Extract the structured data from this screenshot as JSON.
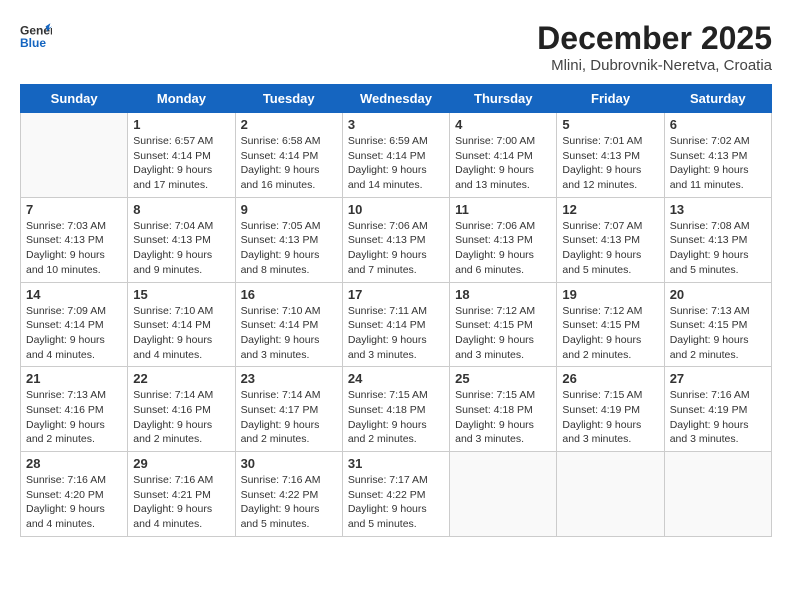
{
  "header": {
    "logo_general": "General",
    "logo_blue": "Blue",
    "title": "December 2025",
    "subtitle": "Mlini, Dubrovnik-Neretva, Croatia"
  },
  "weekdays": [
    "Sunday",
    "Monday",
    "Tuesday",
    "Wednesday",
    "Thursday",
    "Friday",
    "Saturday"
  ],
  "weeks": [
    [
      {
        "day": "",
        "sunrise": "",
        "sunset": "",
        "daylight": ""
      },
      {
        "day": "1",
        "sunrise": "Sunrise: 6:57 AM",
        "sunset": "Sunset: 4:14 PM",
        "daylight": "Daylight: 9 hours and 17 minutes."
      },
      {
        "day": "2",
        "sunrise": "Sunrise: 6:58 AM",
        "sunset": "Sunset: 4:14 PM",
        "daylight": "Daylight: 9 hours and 16 minutes."
      },
      {
        "day": "3",
        "sunrise": "Sunrise: 6:59 AM",
        "sunset": "Sunset: 4:14 PM",
        "daylight": "Daylight: 9 hours and 14 minutes."
      },
      {
        "day": "4",
        "sunrise": "Sunrise: 7:00 AM",
        "sunset": "Sunset: 4:14 PM",
        "daylight": "Daylight: 9 hours and 13 minutes."
      },
      {
        "day": "5",
        "sunrise": "Sunrise: 7:01 AM",
        "sunset": "Sunset: 4:13 PM",
        "daylight": "Daylight: 9 hours and 12 minutes."
      },
      {
        "day": "6",
        "sunrise": "Sunrise: 7:02 AM",
        "sunset": "Sunset: 4:13 PM",
        "daylight": "Daylight: 9 hours and 11 minutes."
      }
    ],
    [
      {
        "day": "7",
        "sunrise": "Sunrise: 7:03 AM",
        "sunset": "Sunset: 4:13 PM",
        "daylight": "Daylight: 9 hours and 10 minutes."
      },
      {
        "day": "8",
        "sunrise": "Sunrise: 7:04 AM",
        "sunset": "Sunset: 4:13 PM",
        "daylight": "Daylight: 9 hours and 9 minutes."
      },
      {
        "day": "9",
        "sunrise": "Sunrise: 7:05 AM",
        "sunset": "Sunset: 4:13 PM",
        "daylight": "Daylight: 9 hours and 8 minutes."
      },
      {
        "day": "10",
        "sunrise": "Sunrise: 7:06 AM",
        "sunset": "Sunset: 4:13 PM",
        "daylight": "Daylight: 9 hours and 7 minutes."
      },
      {
        "day": "11",
        "sunrise": "Sunrise: 7:06 AM",
        "sunset": "Sunset: 4:13 PM",
        "daylight": "Daylight: 9 hours and 6 minutes."
      },
      {
        "day": "12",
        "sunrise": "Sunrise: 7:07 AM",
        "sunset": "Sunset: 4:13 PM",
        "daylight": "Daylight: 9 hours and 5 minutes."
      },
      {
        "day": "13",
        "sunrise": "Sunrise: 7:08 AM",
        "sunset": "Sunset: 4:13 PM",
        "daylight": "Daylight: 9 hours and 5 minutes."
      }
    ],
    [
      {
        "day": "14",
        "sunrise": "Sunrise: 7:09 AM",
        "sunset": "Sunset: 4:14 PM",
        "daylight": "Daylight: 9 hours and 4 minutes."
      },
      {
        "day": "15",
        "sunrise": "Sunrise: 7:10 AM",
        "sunset": "Sunset: 4:14 PM",
        "daylight": "Daylight: 9 hours and 4 minutes."
      },
      {
        "day": "16",
        "sunrise": "Sunrise: 7:10 AM",
        "sunset": "Sunset: 4:14 PM",
        "daylight": "Daylight: 9 hours and 3 minutes."
      },
      {
        "day": "17",
        "sunrise": "Sunrise: 7:11 AM",
        "sunset": "Sunset: 4:14 PM",
        "daylight": "Daylight: 9 hours and 3 minutes."
      },
      {
        "day": "18",
        "sunrise": "Sunrise: 7:12 AM",
        "sunset": "Sunset: 4:15 PM",
        "daylight": "Daylight: 9 hours and 3 minutes."
      },
      {
        "day": "19",
        "sunrise": "Sunrise: 7:12 AM",
        "sunset": "Sunset: 4:15 PM",
        "daylight": "Daylight: 9 hours and 2 minutes."
      },
      {
        "day": "20",
        "sunrise": "Sunrise: 7:13 AM",
        "sunset": "Sunset: 4:15 PM",
        "daylight": "Daylight: 9 hours and 2 minutes."
      }
    ],
    [
      {
        "day": "21",
        "sunrise": "Sunrise: 7:13 AM",
        "sunset": "Sunset: 4:16 PM",
        "daylight": "Daylight: 9 hours and 2 minutes."
      },
      {
        "day": "22",
        "sunrise": "Sunrise: 7:14 AM",
        "sunset": "Sunset: 4:16 PM",
        "daylight": "Daylight: 9 hours and 2 minutes."
      },
      {
        "day": "23",
        "sunrise": "Sunrise: 7:14 AM",
        "sunset": "Sunset: 4:17 PM",
        "daylight": "Daylight: 9 hours and 2 minutes."
      },
      {
        "day": "24",
        "sunrise": "Sunrise: 7:15 AM",
        "sunset": "Sunset: 4:18 PM",
        "daylight": "Daylight: 9 hours and 2 minutes."
      },
      {
        "day": "25",
        "sunrise": "Sunrise: 7:15 AM",
        "sunset": "Sunset: 4:18 PM",
        "daylight": "Daylight: 9 hours and 3 minutes."
      },
      {
        "day": "26",
        "sunrise": "Sunrise: 7:15 AM",
        "sunset": "Sunset: 4:19 PM",
        "daylight": "Daylight: 9 hours and 3 minutes."
      },
      {
        "day": "27",
        "sunrise": "Sunrise: 7:16 AM",
        "sunset": "Sunset: 4:19 PM",
        "daylight": "Daylight: 9 hours and 3 minutes."
      }
    ],
    [
      {
        "day": "28",
        "sunrise": "Sunrise: 7:16 AM",
        "sunset": "Sunset: 4:20 PM",
        "daylight": "Daylight: 9 hours and 4 minutes."
      },
      {
        "day": "29",
        "sunrise": "Sunrise: 7:16 AM",
        "sunset": "Sunset: 4:21 PM",
        "daylight": "Daylight: 9 hours and 4 minutes."
      },
      {
        "day": "30",
        "sunrise": "Sunrise: 7:16 AM",
        "sunset": "Sunset: 4:22 PM",
        "daylight": "Daylight: 9 hours and 5 minutes."
      },
      {
        "day": "31",
        "sunrise": "Sunrise: 7:17 AM",
        "sunset": "Sunset: 4:22 PM",
        "daylight": "Daylight: 9 hours and 5 minutes."
      },
      {
        "day": "",
        "sunrise": "",
        "sunset": "",
        "daylight": ""
      },
      {
        "day": "",
        "sunrise": "",
        "sunset": "",
        "daylight": ""
      },
      {
        "day": "",
        "sunrise": "",
        "sunset": "",
        "daylight": ""
      }
    ]
  ]
}
